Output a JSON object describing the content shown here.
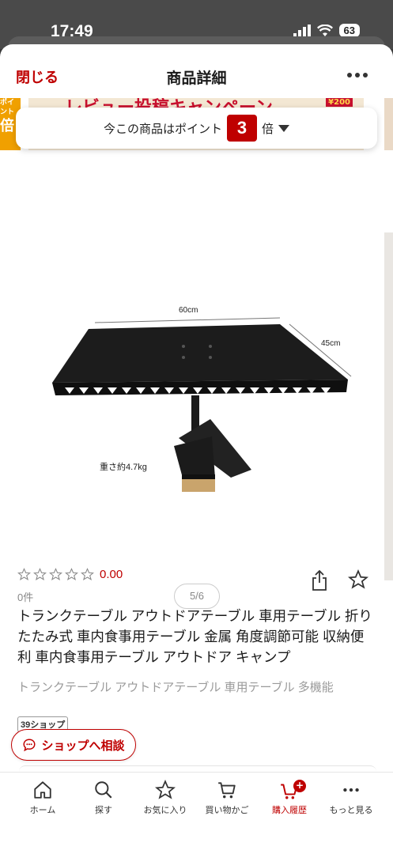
{
  "status_bar": {
    "time": "17:49",
    "battery": "63"
  },
  "header": {
    "close_label": "閉じる",
    "title": "商品詳細"
  },
  "banner": {
    "text": "レビュー投稿キャンペーン",
    "badge": "¥200",
    "left_peek_lines": [
      "ポイ",
      "ント",
      "倍"
    ]
  },
  "points": {
    "prefix": "今この商品はポイント",
    "multiplier": "3",
    "suffix": "倍"
  },
  "image_labels": {
    "width": "60cm",
    "depth": "45cm",
    "weight": "重さ約4.7kg"
  },
  "pager": "5/6",
  "rating": {
    "score": "0.00",
    "stars_filled": 0,
    "stars_total": 5,
    "count": "0件"
  },
  "product": {
    "title": "トランクテーブル アウトドアテーブル 車用テーブル 折りたたみ式 車内食事用テーブル 金属 角度調節可能 収納便利 車内食事用テーブル アウトドア キャンプ",
    "subtitle": "トランクテーブル アウトドアテーブル 車用テーブル 多機能"
  },
  "shop": {
    "tag": "39ショップ",
    "consult_label": "ショップへ相談"
  },
  "tabbar": {
    "items": [
      {
        "label": "ホーム",
        "icon": "home-icon"
      },
      {
        "label": "探す",
        "icon": "search-icon"
      },
      {
        "label": "お気に入り",
        "icon": "star-icon"
      },
      {
        "label": "買い物かご",
        "icon": "cart-icon"
      },
      {
        "label": "購入履歴",
        "icon": "purchase-history-icon",
        "active": true
      },
      {
        "label": "もっと見る",
        "icon": "more-icon"
      }
    ]
  },
  "colors": {
    "accent": "#bf0000",
    "text": "#1a1a1a",
    "muted": "#9a9a9a"
  }
}
